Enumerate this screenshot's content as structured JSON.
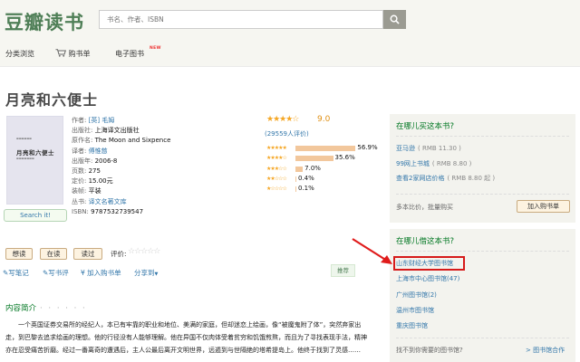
{
  "header": {
    "logo": "豆瓣读书",
    "search_placeholder": "书名、作者、ISBN"
  },
  "nav": {
    "browse": "分类浏览",
    "cart": "购书单",
    "ebooks": "电子图书",
    "new_badge": "NEW"
  },
  "book": {
    "title": "月亮和六便士",
    "cover_title": "月亮和六便士",
    "search_it": "Search it!",
    "info": [
      {
        "label": "作者: ",
        "value": "[英] 毛姆",
        "link": true
      },
      {
        "label": "出版社: ",
        "value": "上海译文出版社",
        "link": false
      },
      {
        "label": "原作名: ",
        "value": "The Moon and Sixpence",
        "link": false
      },
      {
        "label": "译者: ",
        "value": "傅惟慈",
        "link": true
      },
      {
        "label": "出版年: ",
        "value": "2006-8",
        "link": false
      },
      {
        "label": "页数: ",
        "value": "275",
        "link": false
      },
      {
        "label": "定价: ",
        "value": "15.00元",
        "link": false
      },
      {
        "label": "装帧: ",
        "value": "平装",
        "link": false
      },
      {
        "label": "丛书: ",
        "value": "译文名著文库",
        "link": true
      },
      {
        "label": "ISBN: ",
        "value": "9787532739547",
        "link": false
      }
    ]
  },
  "rating": {
    "score": "9.0",
    "stars_value": 4.5,
    "count_text": "(29559人评价)",
    "breakdown": [
      {
        "stars": 5,
        "percent": 56.9,
        "label": "56.9%"
      },
      {
        "stars": 4,
        "percent": 35.6,
        "label": "35.6%"
      },
      {
        "stars": 3,
        "percent": 7.0,
        "label": "7.0%"
      },
      {
        "stars": 2,
        "percent": 0.4,
        "label": "0.4%"
      },
      {
        "stars": 1,
        "percent": 0.1,
        "label": "0.1%"
      }
    ]
  },
  "actions": {
    "want": "想读",
    "reading": "在读",
    "read": "读过",
    "rate_label": "评价:",
    "write_note": "写笔记",
    "write_review": "写书评",
    "add_cart": "加入购书单",
    "share": "分享到",
    "share_arrow": "▼",
    "recommend": "推荐"
  },
  "intro": {
    "heading": "内容简介",
    "dots": "· · · · · ·",
    "text": "一个英国证券交易所的经纪人，本已有牢靠的职业和地位、美满的家庭，但却迷恋上绘画，像“被魔鬼附了体”，突然弃家出走，到巴黎去追求绘画的理想。他的行径没有人能够理解。他在异国不仅肉体受着贫穷和饥饿煎熬，而且为了寻找表现手法，精神亦在忍受痛苦折磨。经过一番离奇的遭遇后，主人公最后离开文明世界，远遁到与世隔绝的塔希提岛上。他终于找到了灵感……"
  },
  "buy": {
    "heading": "在哪儿买这本书?",
    "stores": [
      {
        "name": "亚马逊",
        "price": "( RMB 11.30 )"
      },
      {
        "name": "99网上书城",
        "price": "( RMB 8.80 )"
      },
      {
        "name": "查看2家网店价格",
        "price": "( RMB 8.80 起 )"
      }
    ],
    "compare": "多本比价，批量购买",
    "add_cart_btn": "加入购书单"
  },
  "borrow": {
    "heading": "在哪儿借这本书?",
    "libraries": [
      "山东财经大学图书馆",
      "上海市中心图书馆(47)",
      "广州图书馆(2)",
      "温州市图书馆",
      "重庆图书馆"
    ],
    "no_lib": "找不到你需要的图书馆?",
    "coop": "> 图书馆合作"
  }
}
